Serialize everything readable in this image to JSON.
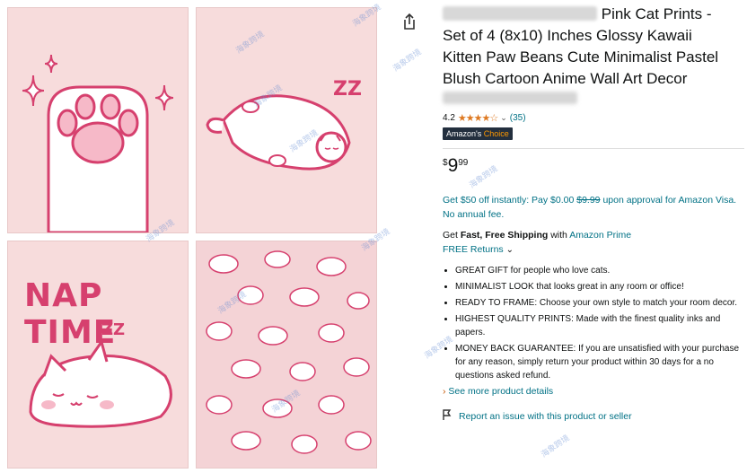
{
  "product": {
    "title_visible": "Pink Cat Prints - Set of 4 (8x10) Inches Glossy Kawaii Kitten Paw Beans Cute Minimalist Pastel Blush Cartoon Anime Wall Art Decor",
    "title_line1": "Pink Cat Prints -",
    "title_line2": "Set of 4 (8x10) Inches Glossy Kawaii",
    "title_line3": "Kitten Paw Beans Cute Minimalist Pastel",
    "title_line4": "Blush Cartoon Anime Wall Art Decor",
    "rating": "4.2",
    "stars": "★★★★☆",
    "review_count": "(35)",
    "badge_prefix": "Amazon's ",
    "badge_suffix": "Choice",
    "price_symbol": "$",
    "price_whole": "9",
    "price_fraction": "99",
    "promo_text_a": "Get $50 off instantly: Pay $0.00 ",
    "promo_strike": "$9.99",
    "promo_text_b": " upon approval for Amazon Visa. No annual fee.",
    "ship_prefix": "Get ",
    "ship_bold": "Fast, Free Shipping",
    "ship_with": " with ",
    "ship_link": "Amazon Prime",
    "returns": "FREE Returns",
    "bullets": [
      "GREAT GIFT for people who love cats.",
      "MINIMALIST LOOK that looks great in any room or office!",
      "READY TO FRAME: Choose your own style to match your room decor.",
      "HIGHEST QUALITY PRINTS: Made with the finest quality inks and papers.",
      "MONEY BACK GUARANTEE: If you are unsatisfied with your purchase for any reason, simply return your product within 30 days for a no questions asked refund."
    ],
    "see_more": "See more product details",
    "report": "Report an issue with this product or seller"
  },
  "images": {
    "nap_time_text": "NAP TIME",
    "zzz_a": "ZZ",
    "zzz_b": "ZZ"
  },
  "colors": {
    "link": "#007185",
    "star": "#de7921",
    "badge_bg": "#232f3e",
    "art_pink": "#d6406e",
    "tile_bg": "#f7dcdc"
  },
  "watermark": "海象跨境",
  "icons": [
    "share-icon",
    "chevron-down-icon",
    "flag-icon"
  ]
}
